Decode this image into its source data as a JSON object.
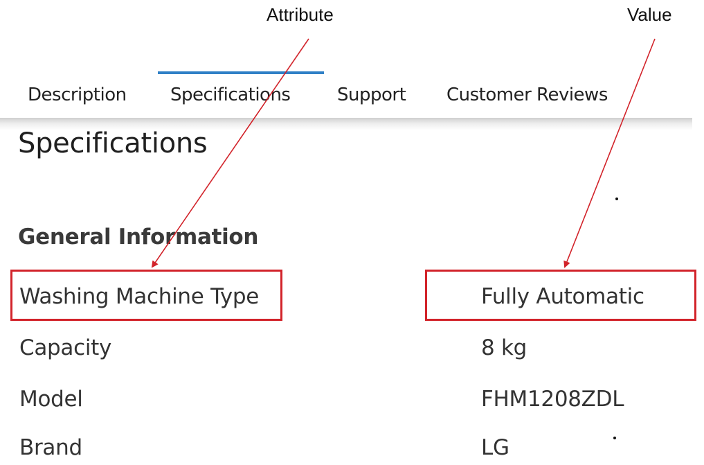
{
  "annotations": {
    "attribute_label": "Attribute",
    "value_label": "Value",
    "arrow_color": "#d2232a"
  },
  "tabs": [
    {
      "label": "Description",
      "active": false
    },
    {
      "label": "Specifications",
      "active": true
    },
    {
      "label": "Support",
      "active": false
    },
    {
      "label": "Customer Reviews",
      "active": false
    }
  ],
  "accent_color": "#2f80c6",
  "page_title": "Specifications",
  "section_title": "General Information",
  "specs": [
    {
      "attribute": "Washing Machine Type",
      "value": "Fully Automatic"
    },
    {
      "attribute": "Capacity",
      "value": "8 kg"
    },
    {
      "attribute": "Model",
      "value": "FHM1208ZDL"
    },
    {
      "attribute": "Brand",
      "value": "LG"
    }
  ]
}
